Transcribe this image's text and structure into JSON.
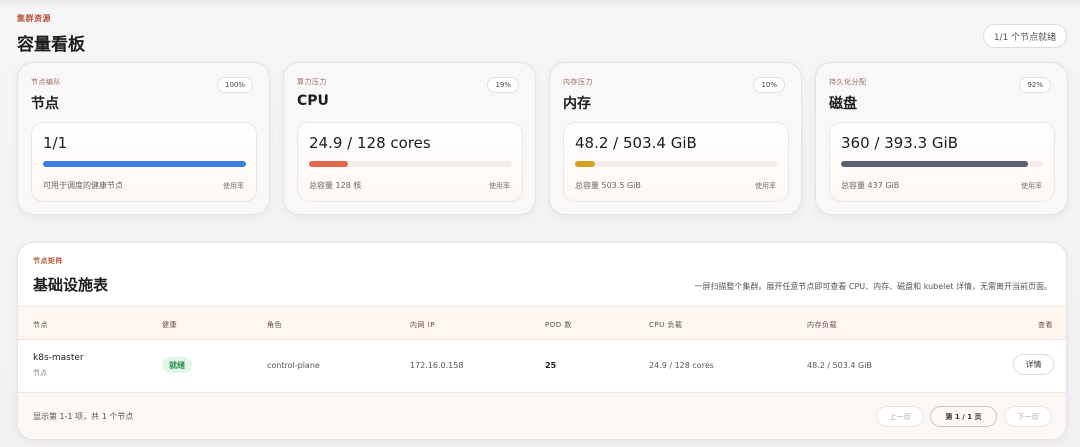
{
  "header": {
    "eyebrow": "集群资源",
    "title": "容量看板",
    "ready_label": "1/1 个节点就绪"
  },
  "cards": [
    {
      "eyebrow": "节点编队",
      "title": "节点",
      "percent": "100%",
      "value": "1/1",
      "caption": "可用于调度的健康节点",
      "usage_label": "使用率",
      "fill_fraction": 1.0,
      "color": "#3b7fe0"
    },
    {
      "eyebrow": "算力压力",
      "title": "CPU",
      "percent": "19%",
      "value": "24.9 / 128 cores",
      "caption": "总容量 128 核",
      "usage_label": "使用率",
      "fill_fraction": 0.19,
      "color": "#e2674c"
    },
    {
      "eyebrow": "内存压力",
      "title": "内存",
      "percent": "10%",
      "value": "48.2 / 503.4 GiB",
      "caption": "总容量 503.5 GiB",
      "usage_label": "使用率",
      "fill_fraction": 0.1,
      "color": "#d5a21f"
    },
    {
      "eyebrow": "持久化分配",
      "title": "磁盘",
      "percent": "92%",
      "value": "360 / 393.3 GiB",
      "caption": "总容量 437 GiB",
      "usage_label": "使用率",
      "fill_fraction": 0.92,
      "color": "#5a6070"
    }
  ],
  "matrix": {
    "eyebrow": "节点矩阵",
    "title": "基础设施表",
    "description": "一屏扫描整个集群。展开任意节点即可查看 CPU、内存、磁盘和 kubelet 详情，无需离开当前页面。",
    "columns": [
      "节点",
      "健康",
      "角色",
      "内网 IP",
      "POD 数",
      "CPU 负载",
      "内存负载",
      "查看"
    ],
    "rows": [
      {
        "name": "k8s-master",
        "sub": "节点",
        "health": "就绪",
        "role": "control-plane",
        "ip": "172.16.0.158",
        "pods": "25",
        "cpu": "24.9 / 128 cores",
        "mem": "48.2 / 503.4 GiB",
        "action": "详情"
      }
    ],
    "footer": {
      "summary": "显示第 1-1 项，共 1 个节点",
      "prev": "上一页",
      "page": "第 1 / 1 页",
      "next": "下一页"
    }
  }
}
